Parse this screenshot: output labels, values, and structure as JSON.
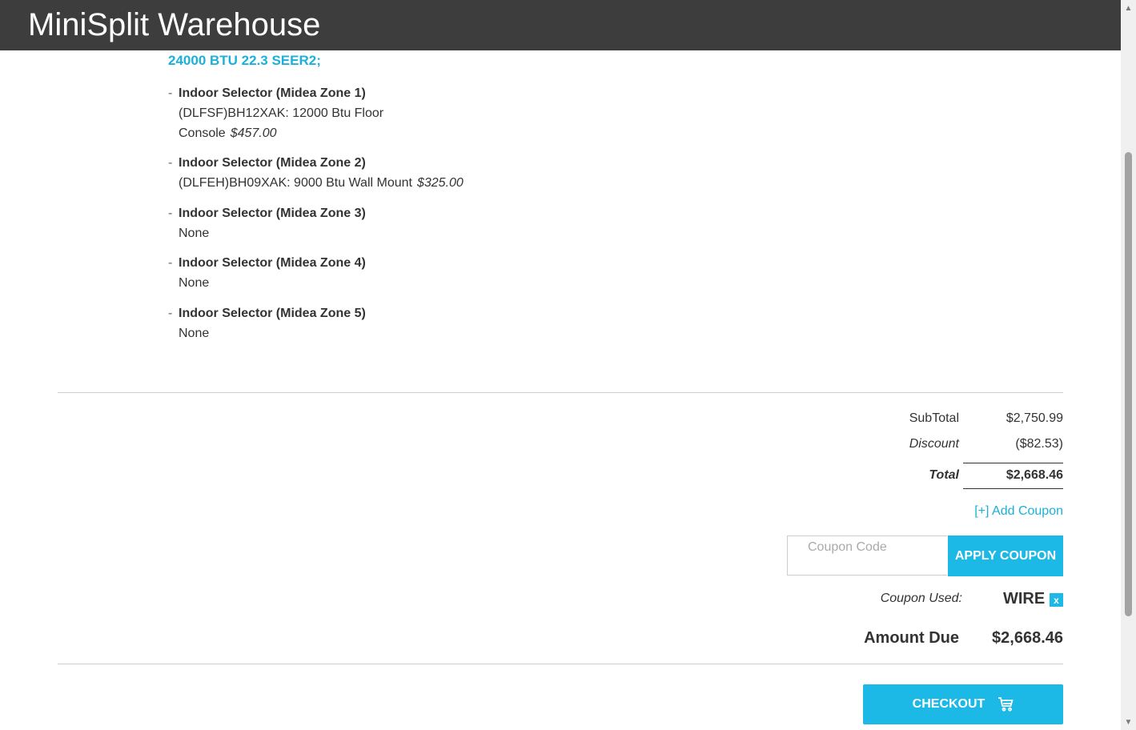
{
  "header": {
    "brand": "MiniSplit Warehouse"
  },
  "product": {
    "title": "24000 BTU 22.3 SEER2;",
    "options": [
      {
        "name": "Indoor Selector (Midea Zone 1)",
        "value": "(DLFSF)BH12XAK: 12000 Btu Floor Console",
        "price": "$457.00"
      },
      {
        "name": "Indoor Selector (Midea Zone 2)",
        "value": "(DLFEH)BH09XAK: 9000 Btu Wall Mount",
        "price": "$325.00"
      },
      {
        "name": "Indoor Selector (Midea Zone 3)",
        "value": "None",
        "price": ""
      },
      {
        "name": "Indoor Selector (Midea Zone 4)",
        "value": "None",
        "price": ""
      },
      {
        "name": "Indoor Selector (Midea Zone 5)",
        "value": "None",
        "price": ""
      }
    ],
    "option_dash": "-"
  },
  "totals": {
    "subtotal_label": "SubTotal",
    "subtotal_value": "$2,750.99",
    "discount_label": "Discount",
    "discount_value": "($82.53)",
    "total_label": "Total",
    "total_value": "$2,668.46"
  },
  "coupon": {
    "add_link": "[+] Add Coupon",
    "input_placeholder": "Coupon Code",
    "input_value": "",
    "apply_label": "APPLY COUPON",
    "used_label": "Coupon Used:",
    "used_code": "WIRE",
    "remove_label": "x"
  },
  "amount_due": {
    "label": "Amount Due",
    "value": "$2,668.46"
  },
  "checkout": {
    "label": "CHECKOUT",
    "icon": "cart-icon"
  },
  "colors": {
    "accent": "#1cb8e6",
    "link": "#1cb0d8",
    "header_bg": "#3d3d3d",
    "text": "#333333"
  }
}
